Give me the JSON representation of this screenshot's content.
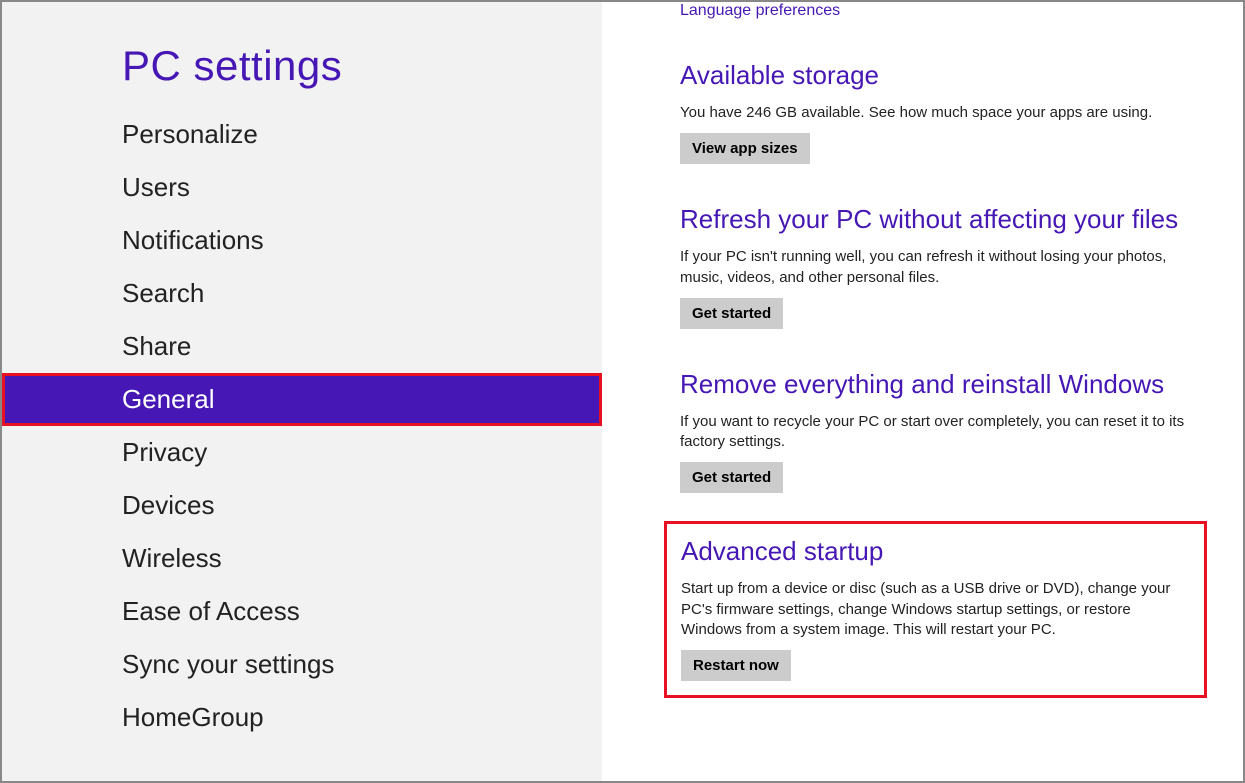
{
  "header": {
    "title": "PC settings"
  },
  "top_link": "Language preferences",
  "sidebar": {
    "items": [
      {
        "label": "Personalize"
      },
      {
        "label": "Users"
      },
      {
        "label": "Notifications"
      },
      {
        "label": "Search"
      },
      {
        "label": "Share"
      },
      {
        "label": "General",
        "selected": true
      },
      {
        "label": "Privacy"
      },
      {
        "label": "Devices"
      },
      {
        "label": "Wireless"
      },
      {
        "label": "Ease of Access"
      },
      {
        "label": "Sync your settings"
      },
      {
        "label": "HomeGroup"
      }
    ]
  },
  "sections": {
    "storage": {
      "title": "Available storage",
      "desc": "You have 246 GB available. See how much space your apps are using.",
      "button": "View app sizes"
    },
    "refresh": {
      "title": "Refresh your PC without affecting your files",
      "desc": "If your PC isn't running well, you can refresh it without losing your photos, music, videos, and other personal files.",
      "button": "Get started"
    },
    "remove": {
      "title": "Remove everything and reinstall Windows",
      "desc": "If you want to recycle your PC or start over completely, you can reset it to its factory settings.",
      "button": "Get started"
    },
    "advanced": {
      "title": "Advanced startup",
      "desc": "Start up from a device or disc (such as a USB drive or DVD), change your PC's firmware settings, change Windows startup settings, or restore Windows from a system image. This will restart your PC.",
      "button": "Restart now"
    }
  }
}
